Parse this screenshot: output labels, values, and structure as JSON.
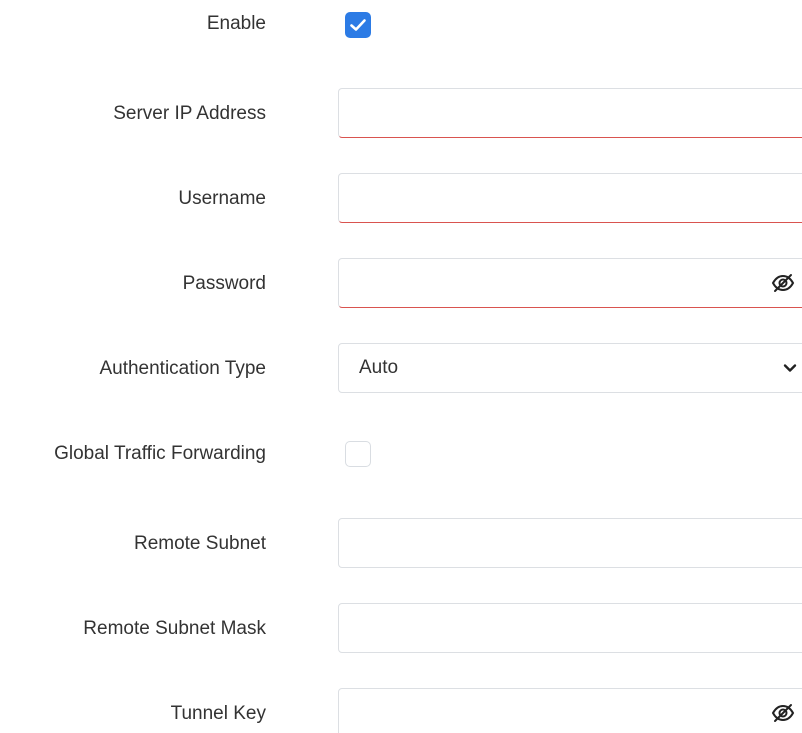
{
  "form": {
    "enable": {
      "label": "Enable",
      "checked": true
    },
    "server_ip": {
      "label": "Server IP Address",
      "value": ""
    },
    "username": {
      "label": "Username",
      "value": ""
    },
    "password": {
      "label": "Password",
      "value": "",
      "icon": "eye-slash-icon"
    },
    "auth_type": {
      "label": "Authentication Type",
      "selected": "Auto",
      "icon": "chevron-down-icon"
    },
    "global_forwarding": {
      "label": "Global Traffic Forwarding",
      "checked": false
    },
    "remote_subnet": {
      "label": "Remote Subnet",
      "value": ""
    },
    "remote_subnet_mask": {
      "label": "Remote Subnet Mask",
      "value": ""
    },
    "tunnel_key": {
      "label": "Tunnel Key",
      "value": "",
      "icon": "eye-slash-icon"
    }
  },
  "colors": {
    "accent": "#2c7be5",
    "invalid_border": "#d9534f",
    "field_border": "#dcdfe3",
    "label_text": "#333333"
  }
}
